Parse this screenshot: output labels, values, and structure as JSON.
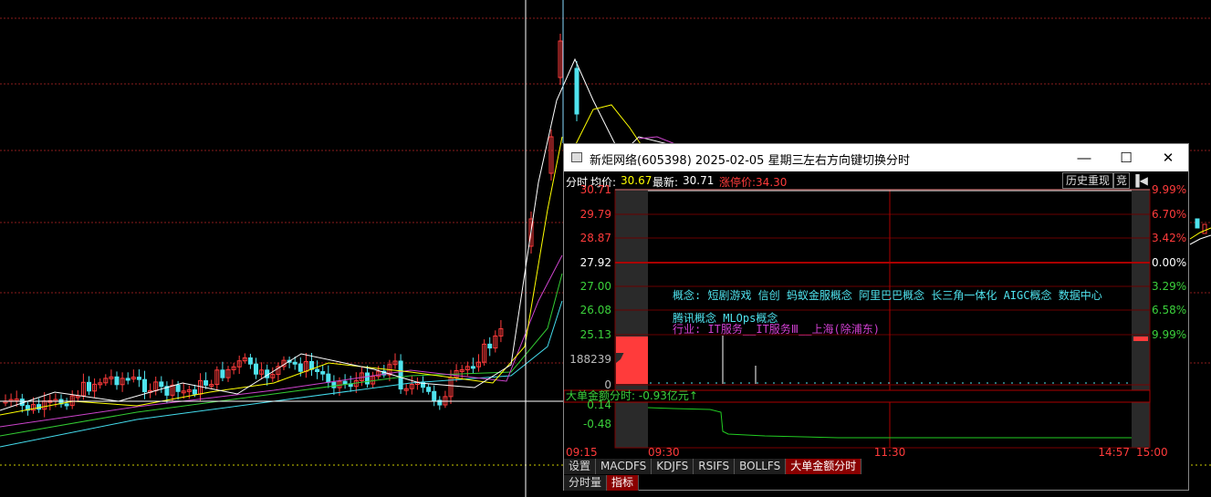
{
  "popup": {
    "title": "新炬网络(605398) 2025-02-05 星期三",
    "hint": "左右方向键切换分时",
    "minimize_symbol": "—",
    "maximize_symbol": "☐",
    "close_symbol": "✕"
  },
  "infobar": {
    "mode_label": "分时",
    "avg_label": "均价:",
    "avg_value": "30.67",
    "latest_label": "最新:",
    "latest_value": "30.71",
    "limit_label": "涨停价:34.30",
    "history_button": "历史重现",
    "jing_button": "竞",
    "back_icon": "▐◀"
  },
  "price_axis_left": [
    "30.71",
    "29.79",
    "28.87",
    "27.92",
    "27.00",
    "26.08",
    "25.13"
  ],
  "pct_axis_right": [
    "9.99%",
    "6.70%",
    "3.42%",
    "0.00%",
    "3.29%",
    "6.58%",
    "9.99%"
  ],
  "volume_axis": [
    "188239",
    "0"
  ],
  "bigorder_axis": [
    "0.14",
    "-0.48"
  ],
  "bigorder_label": "大单金额分时: -0.93亿元↑",
  "time_axis": [
    "09:15",
    "09:30",
    "11:30",
    "14:57",
    "15:00"
  ],
  "concepts": {
    "line1": "概念: 短剧游戏 信创 蚂蚁金服概念 阿里巴巴概念 长三角一体化 AIGC概念 数据中心",
    "line2": "腾讯概念 MLOps概念",
    "line3": "行业: IT服务__IT服务Ⅲ__上海(除浦东)"
  },
  "tabs": [
    "设置",
    "MACDFS",
    "KDJFS",
    "RSIFS",
    "BOLLFS",
    "大单金额分时"
  ],
  "active_tab": "大单金额分时",
  "tabs2": [
    "分时量",
    "指标"
  ],
  "active_tab2": "指标",
  "colors": {
    "up": "#ff3b3b",
    "down": "#4fe3ee",
    "grid": "#6a0000",
    "crosshair": "#ffffff",
    "price_line": "#ffffff",
    "avg_line": "#ffff00",
    "bigorder_line": "#22cc22"
  },
  "kline_chart": {
    "price_tag_top": "30.71"
  }
}
